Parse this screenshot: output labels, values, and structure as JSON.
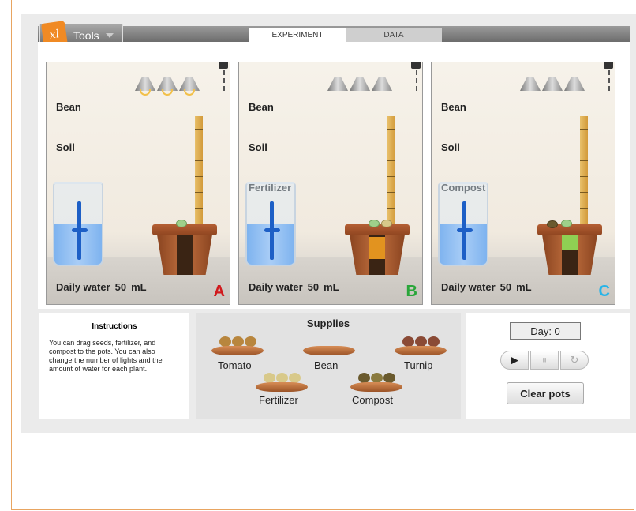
{
  "header": {
    "logo_text": "xl",
    "tools_label": "Tools",
    "tabs": [
      {
        "label": "EXPERIMENT"
      },
      {
        "label": "DATA"
      }
    ]
  },
  "chambers": [
    {
      "lines": [
        "Bean",
        "Soil"
      ],
      "water_label": "Daily water",
      "water_value": "50",
      "water_unit": "mL",
      "letter": "A",
      "letter_color": "#d0191c"
    },
    {
      "lines": [
        "Bean",
        "Soil",
        "Fertilizer"
      ],
      "water_label": "Daily water",
      "water_value": "50",
      "water_unit": "mL",
      "letter": "B",
      "letter_color": "#2aa63a"
    },
    {
      "lines": [
        "Bean",
        "Soil",
        "Compost"
      ],
      "water_label": "Daily water",
      "water_value": "50",
      "water_unit": "mL",
      "letter": "C",
      "letter_color": "#27b4e8"
    }
  ],
  "instructions": {
    "title": "Instructions",
    "text": "You can drag seeds, fertilizer, and compost to the pots. You can also change the number of lights and the amount of water for each plant."
  },
  "supplies": {
    "title": "Supplies",
    "items": [
      {
        "label": "Tomato",
        "color": "#b8863e"
      },
      {
        "label": "Bean",
        "color": "#b56a3c"
      },
      {
        "label": "Turnip",
        "color": "#8a4a35"
      },
      {
        "label": "Fertilizer",
        "color": "#d8c98a"
      },
      {
        "label": "Compost",
        "color": "#6a5a2e"
      }
    ]
  },
  "controls": {
    "day_text": "Day: 0",
    "play_icon": "▶",
    "pause_icon": "⏸",
    "reset_icon": "↻",
    "clear_label": "Clear pots"
  }
}
